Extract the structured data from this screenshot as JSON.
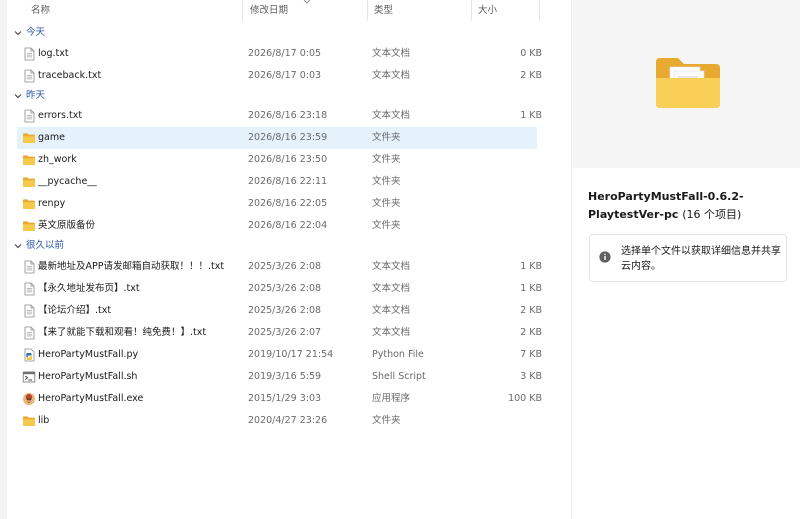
{
  "columns": {
    "name": "名称",
    "date": "修改日期",
    "type": "类型",
    "size": "大小"
  },
  "groups": {
    "today": "今天",
    "yesterday": "昨天",
    "long_ago": "很久以前"
  },
  "files": [
    {
      "name": "log.txt",
      "date": "2026/8/17 0:05",
      "type": "文本文档",
      "size": "0 KB",
      "icon": "text-file-icon"
    },
    {
      "name": "traceback.txt",
      "date": "2026/8/17 0:03",
      "type": "文本文档",
      "size": "2 KB",
      "icon": "text-file-icon"
    },
    {
      "name": "errors.txt",
      "date": "2026/8/16 23:18",
      "type": "文本文档",
      "size": "1 KB",
      "icon": "text-file-icon"
    },
    {
      "name": "game",
      "date": "2026/8/16 23:59",
      "type": "文件夹",
      "size": "",
      "icon": "folder-icon"
    },
    {
      "name": "zh_work",
      "date": "2026/8/16 23:50",
      "type": "文件夹",
      "size": "",
      "icon": "folder-icon"
    },
    {
      "name": "__pycache__",
      "date": "2026/8/16 22:11",
      "type": "文件夹",
      "size": "",
      "icon": "folder-icon"
    },
    {
      "name": "renpy",
      "date": "2026/8/16 22:05",
      "type": "文件夹",
      "size": "",
      "icon": "folder-icon"
    },
    {
      "name": "英文原版备份",
      "date": "2026/8/16 22:04",
      "type": "文件夹",
      "size": "",
      "icon": "folder-icon"
    },
    {
      "name": "最新地址及APP请发邮箱自动获取！！！.txt",
      "date": "2025/3/26 2:08",
      "type": "文本文档",
      "size": "1 KB",
      "icon": "text-file-icon"
    },
    {
      "name": "【永久地址发布页】.txt",
      "date": "2025/3/26 2:08",
      "type": "文本文档",
      "size": "1 KB",
      "icon": "text-file-icon"
    },
    {
      "name": "【论坛介绍】.txt",
      "date": "2025/3/26 2:08",
      "type": "文本文档",
      "size": "2 KB",
      "icon": "text-file-icon"
    },
    {
      "name": "【来了就能下载和观看！纯免费！】.txt",
      "date": "2025/3/26 2:07",
      "type": "文本文档",
      "size": "2 KB",
      "icon": "text-file-icon"
    },
    {
      "name": "HeroPartyMustFall.py",
      "date": "2019/10/17 21:54",
      "type": "Python File",
      "size": "7 KB",
      "icon": "python-file-icon"
    },
    {
      "name": "HeroPartyMustFall.sh",
      "date": "2019/3/16 5:59",
      "type": "Shell Script",
      "size": "3 KB",
      "icon": "shell-script-icon"
    },
    {
      "name": "HeroPartyMustFall.exe",
      "date": "2015/1/29 3:03",
      "type": "应用程序",
      "size": "100 KB",
      "icon": "application-icon"
    },
    {
      "name": "lib",
      "date": "2020/4/27 23:26",
      "type": "文件夹",
      "size": "",
      "icon": "folder-icon"
    }
  ],
  "preview": {
    "title": "HeroPartyMustFall-0.6.2-PlaytestVer-pc",
    "count": "(16 个项目)",
    "info": "选择单个文件以获取详细信息并共享云内容。"
  },
  "colors": {
    "group_header": "#2b55a8",
    "selection": "#e5f1fb",
    "folder": "#f7c94b",
    "preview_bg": "#f5f5f5"
  }
}
